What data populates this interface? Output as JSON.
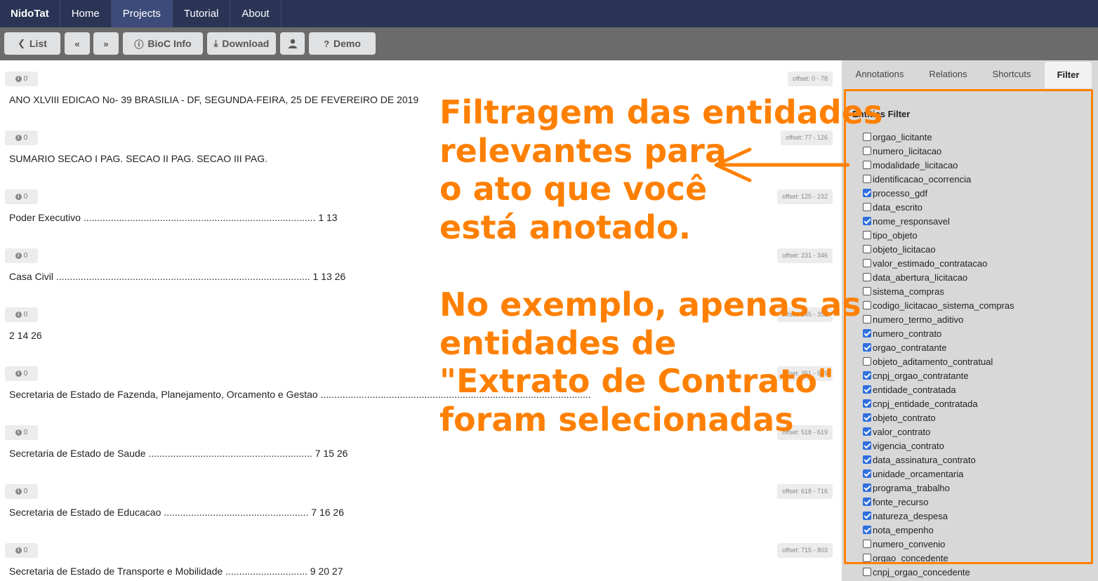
{
  "nav": {
    "brand": "NidoTat",
    "items": [
      {
        "label": "Home",
        "active": false
      },
      {
        "label": "Projects",
        "active": true
      },
      {
        "label": "Tutorial",
        "active": false
      },
      {
        "label": "About",
        "active": false
      }
    ]
  },
  "toolbar": {
    "list_label": "List",
    "bioc_label": "BioC Info",
    "download_label": "Download",
    "demo_label": "Demo"
  },
  "document": {
    "passages": [
      {
        "count": "0",
        "offset": "offset: 0 - 78",
        "text": "ANO XLVIII EDICAO No- 39 BRASILIA - DF, SEGUNDA-FEIRA, 25 DE FEVEREIRO DE 2019"
      },
      {
        "count": "0",
        "offset": "offset: 77 - 126",
        "text": "SUMARIO SECAO I PAG. SECAO II PAG. SECAO III PAG."
      },
      {
        "count": "0",
        "offset": "offset: 125 - 232",
        "text": "Poder Executivo ..................................................................................... 1 13"
      },
      {
        "count": "0",
        "offset": "offset: 231 - 346",
        "text": "Casa Civil ............................................................................................. 1 13 26"
      },
      {
        "count": "0",
        "offset": "offset: 345 - 352",
        "text": "2 14 26"
      },
      {
        "count": "0",
        "offset": "offset: 351 - 519",
        "text": "Secretaria de Estado de Fazenda, Planejamento, Orcamento e Gestao ..................................................................................................."
      },
      {
        "count": "0",
        "offset": "offset: 518 - 619",
        "text": "Secretaria de Estado de Saude ............................................................ 7 15 26"
      },
      {
        "count": "0",
        "offset": "offset: 618 - 716",
        "text": "Secretaria de Estado de Educacao ..................................................... 7 16 26"
      },
      {
        "count": "0",
        "offset": "offset: 715 - 803",
        "text": "Secretaria de Estado de Transporte e Mobilidade .............................. 9 20 27"
      }
    ]
  },
  "panel": {
    "tabs": [
      {
        "label": "Annotations",
        "active": false
      },
      {
        "label": "Relations",
        "active": false
      },
      {
        "label": "Shortcuts",
        "active": false
      },
      {
        "label": "Filter",
        "active": true
      }
    ],
    "filter_title": "Entities Filter",
    "entities": [
      {
        "name": "orgao_licitante",
        "checked": false
      },
      {
        "name": "numero_licitacao",
        "checked": false
      },
      {
        "name": "modalidade_licitacao",
        "checked": false
      },
      {
        "name": "identificacao_ocorrencia",
        "checked": false
      },
      {
        "name": "processo_gdf",
        "checked": true
      },
      {
        "name": "data_escrito",
        "checked": false
      },
      {
        "name": "nome_responsavel",
        "checked": true
      },
      {
        "name": "tipo_objeto",
        "checked": false
      },
      {
        "name": "objeto_licitacao",
        "checked": false
      },
      {
        "name": "valor_estimado_contratacao",
        "checked": false
      },
      {
        "name": "data_abertura_licitacao",
        "checked": false
      },
      {
        "name": "sistema_compras",
        "checked": false
      },
      {
        "name": "codigo_licitacao_sistema_compras",
        "checked": false
      },
      {
        "name": "numero_termo_aditivo",
        "checked": false
      },
      {
        "name": "numero_contrato",
        "checked": true
      },
      {
        "name": "orgao_contratante",
        "checked": true
      },
      {
        "name": "objeto_aditamento_contratual",
        "checked": false
      },
      {
        "name": "cnpj_orgao_contratante",
        "checked": true
      },
      {
        "name": "entidade_contratada",
        "checked": true
      },
      {
        "name": "cnpj_entidade_contratada",
        "checked": true
      },
      {
        "name": "objeto_contrato",
        "checked": true
      },
      {
        "name": "valor_contrato",
        "checked": true
      },
      {
        "name": "vigencia_contrato",
        "checked": true
      },
      {
        "name": "data_assinatura_contrato",
        "checked": true
      },
      {
        "name": "unidade_orcamentaria",
        "checked": true
      },
      {
        "name": "programa_trabalho",
        "checked": true
      },
      {
        "name": "fonte_recurso",
        "checked": true
      },
      {
        "name": "natureza_despesa",
        "checked": true
      },
      {
        "name": "nota_empenho",
        "checked": true
      },
      {
        "name": "numero_convenio",
        "checked": false
      },
      {
        "name": "orgao_concedente",
        "checked": false
      },
      {
        "name": "cnpj_orgao_concedente",
        "checked": false
      }
    ]
  },
  "annotation": {
    "lines_top": [
      "Filtragem das entidades",
      "relevantes para",
      "o ato que você",
      "está anotado."
    ],
    "lines_bottom": [
      "No exemplo, apenas as",
      "entidades de",
      "\"Extrato de Contrato\"",
      "foram selecionadas"
    ],
    "color": "#ff8000"
  }
}
